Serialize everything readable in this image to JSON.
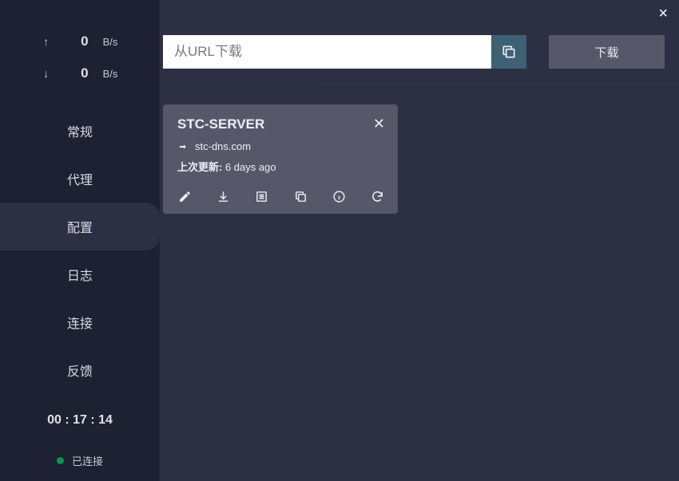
{
  "close_icon": "×",
  "stats": {
    "up_value": "0",
    "up_unit": "B/s",
    "down_value": "0",
    "down_unit": "B/s"
  },
  "nav": {
    "general": "常规",
    "proxy": "代理",
    "config": "配置",
    "log": "日志",
    "connection": "连接",
    "feedback": "反馈"
  },
  "timer": "00 : 17 : 14",
  "status_text": "已连接",
  "url_bar": {
    "placeholder": "从URL下载",
    "download_label": "下载"
  },
  "profile": {
    "name": "STC-SERVER",
    "domain": "stc-dns.com",
    "update_label": "上次更新:",
    "update_value": "6 days ago"
  }
}
